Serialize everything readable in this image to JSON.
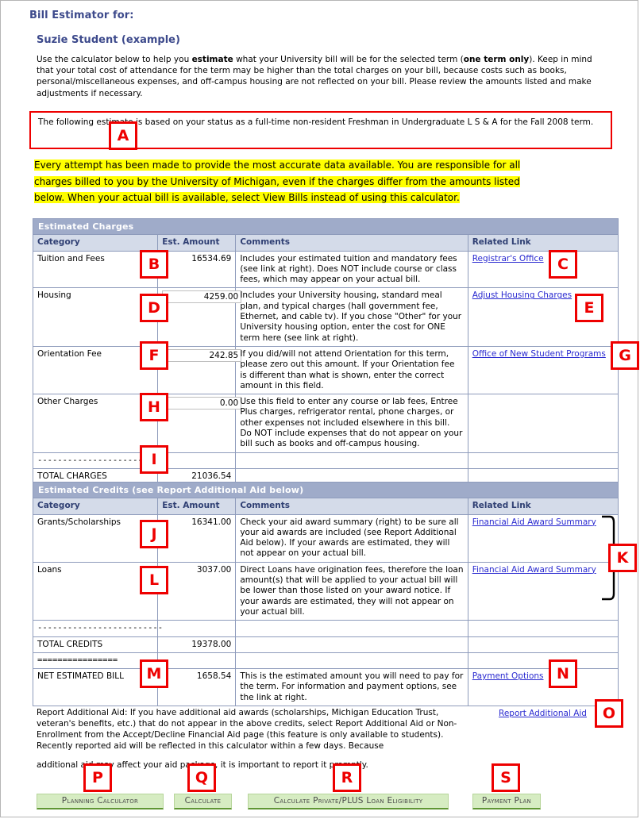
{
  "header": {
    "title": "Bill Estimator for:",
    "student_name": "Suzie Student (example)"
  },
  "intro": {
    "text_part1": "Use the calculator below to help you ",
    "bold1": "estimate",
    "text_part2": " what your University bill will be for the selected term (",
    "bold2": "one term only",
    "text_part3": "). Keep in mind that your total cost of attendance for the term may be higher than the total charges on your bill, because costs such as books, personal/miscellaneous expenses, and off-campus housing are not reflected on your bill. Please review the amounts listed and make adjustments if necessary."
  },
  "status_box": {
    "text": "The following estimate is based on your status as a full-time non-resident Freshman in Undergraduate L S & A for the Fall 2008 term."
  },
  "warning": {
    "line1": "Every attempt has been made to provide the most accurate data available. You are responsible for all",
    "line2": "charges billed to you by the University of Michigan, even if the charges differ from the amounts listed",
    "line3": "below. When your actual bill is available, select View Bills instead of using this calculator."
  },
  "charges_table": {
    "section_title": "Estimated Charges",
    "columns": [
      "Category",
      "Est. Amount",
      "Comments",
      "Related Link"
    ],
    "rows": [
      {
        "category": "Tuition and Fees",
        "amount": "16534.69",
        "editable": false,
        "comment": "Includes your estimated tuition and mandatory fees (see link at right).  Does NOT include course or class fees, which may appear on your actual bill.",
        "link": "Registrar's Office"
      },
      {
        "category": "Housing",
        "amount": "4259.00",
        "editable": true,
        "comment": "Includes your University housing, standard meal plan, and typical charges (hall government fee, Ethernet, and cable tv).  If you chose \"Other\" for your University housing option, enter the cost for ONE term here (see link at right).",
        "link": "Adjust Housing Charges"
      },
      {
        "category": "Orientation Fee",
        "amount": "242.85",
        "editable": true,
        "comment": "If you did/will not attend Orientation for this term, please zero out this amount. If your Orientation fee is different than what is shown, enter the correct amount in this field.",
        "link": "Office of New Student Programs"
      },
      {
        "category": "Other Charges",
        "amount": "0.00",
        "editable": true,
        "comment": "Use this field to enter any course or lab fees, Entree Plus charges, refrigerator rental, phone charges, or other expenses not included elsewhere in this bill.  Do NOT include expenses that do not appear on your bill such as books and off-campus housing.",
        "link": ""
      }
    ],
    "separator": "-----------------------",
    "total_label": "TOTAL CHARGES",
    "total_amount": "21036.54"
  },
  "credits_table": {
    "section_title": "Estimated Credits (see Report Additional Aid below)",
    "columns": [
      "Category",
      "Est. Amount",
      "Comments",
      "Related Link"
    ],
    "rows": [
      {
        "category": "Grants/Scholarships",
        "amount": "16341.00",
        "comment": "Check your aid award summary (right) to be sure all your aid awards are included (see Report Additional Aid below). If your awards are estimated, they will not appear on your actual bill.",
        "link": "Financial Aid Award Summary"
      },
      {
        "category": "Loans",
        "amount": "3037.00",
        "comment": "Direct Loans have origination fees, therefore the loan amount(s) that will be applied to your actual bill will be lower than those listed on your award notice. If your awards are estimated, they will not appear on your actual bill.",
        "link": "Financial Aid Award Summary"
      }
    ],
    "separator": "-------------------------",
    "total_label": "TOTAL CREDITS",
    "total_amount": "19378.00",
    "equals_separator": "================",
    "net_label": "NET ESTIMATED BILL",
    "net_amount": "1658.54",
    "net_comment": "This is the estimated amount you will need to pay for the term. For information and payment options, see the link at right.",
    "net_link": "Payment Options"
  },
  "note": {
    "paragraph1": "Report Additional Aid: If you have additional aid awards (scholarships, Michigan Education Trust, veteran's benefits, etc.) that do not appear in the above credits, select Report Additional Aid or Non-Enrollment from the Accept/Decline Financial Aid page (this feature is only available to students). Recently reported aid will be reflected in this calculator within a few days. Because",
    "paragraph2": "additional aid may affect your aid package, it is important to report it promptly.",
    "report_link": "Report Additional Aid"
  },
  "buttons": {
    "planning_calculator": "Planning Calculator",
    "calculate": "Calculate",
    "private_plus": "Calculate Private/PLUS Loan Eligibility",
    "payment_plan": "Payment Plan"
  },
  "markers": {
    "a": "A",
    "b": "B",
    "c": "C",
    "d": "D",
    "e": "E",
    "f": "F",
    "g": "G",
    "h": "H",
    "i": "I",
    "j": "J",
    "k": "K",
    "l": "L",
    "m": "M",
    "n": "N",
    "o": "O",
    "p": "P",
    "q": "Q",
    "r": "R",
    "s": "S"
  },
  "colors": {
    "heading": "#3d4a8c",
    "section_header_bg": "#9fabc9",
    "column_header_bg": "#d4dbe9",
    "table_border": "#8e9bbb",
    "link": "#2a2ad0",
    "marker_red": "#ee0000",
    "highlight_yellow": "#ffff00",
    "button_bg": "#d6ecc2"
  }
}
